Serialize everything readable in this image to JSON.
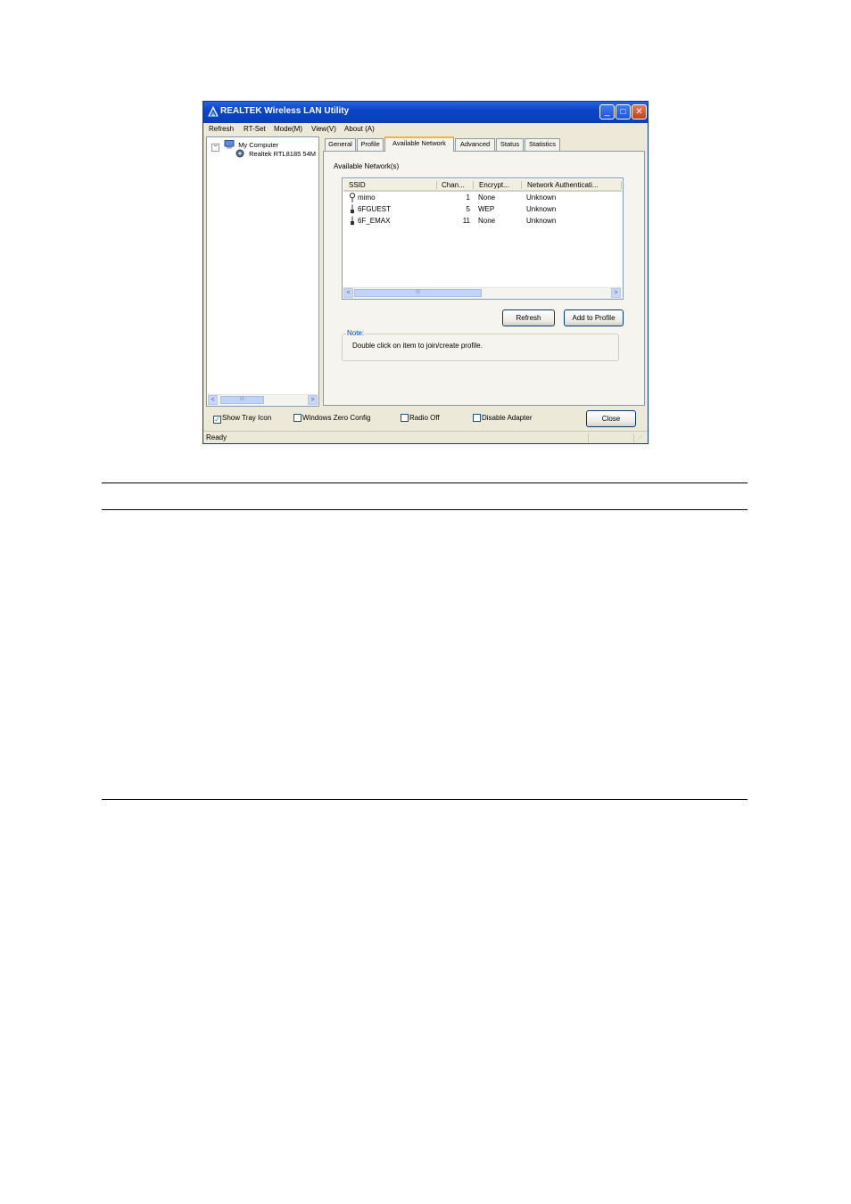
{
  "window": {
    "title": "REALTEK Wireless LAN Utility",
    "title_buttons": {
      "minimize": "_",
      "maximize": "□",
      "close": "✕"
    }
  },
  "menu": [
    "Refresh",
    "RT-Set",
    "Mode(M)",
    "View(V)",
    "About (A)"
  ],
  "tree": {
    "root": "My Computer",
    "child": "Realtek RTL8185 54M"
  },
  "tabs": [
    "General",
    "Profile",
    "Available Network",
    "Advanced",
    "Status",
    "Statistics"
  ],
  "active_tab": "Available Network",
  "available_networks_label": "Available Network(s)",
  "list": {
    "columns": [
      "SSID",
      "Chan...",
      "Encrypt...",
      "Network Authenticati..."
    ],
    "rows": [
      {
        "icon": "infrastructure-icon",
        "ssid": "mimo",
        "channel": "1",
        "encryption": "None",
        "auth": "Unknown"
      },
      {
        "icon": "adhoc-icon",
        "ssid": "6FGUEST",
        "channel": "5",
        "encryption": "WEP",
        "auth": "Unknown"
      },
      {
        "icon": "adhoc-icon",
        "ssid": "6F_EMAX",
        "channel": "11",
        "encryption": "None",
        "auth": "Unknown"
      }
    ]
  },
  "buttons": {
    "refresh": "Refresh",
    "add_to_profile": "Add to Profile",
    "close": "Close"
  },
  "note": {
    "title": "Note:",
    "text": "Double click on item to join/create profile."
  },
  "checkboxes": [
    {
      "label": "Show Tray Icon",
      "checked": true
    },
    {
      "label": "Windows Zero Config",
      "checked": false
    },
    {
      "label": "Radio Off",
      "checked": false
    },
    {
      "label": "Disable Adapter",
      "checked": false
    }
  ],
  "status": "Ready",
  "colors": {
    "titlebar": "#0a46c8",
    "window_bg": "#ece9d8",
    "tab_highlight": "#f2b63a",
    "note_title": "#0046d5"
  }
}
